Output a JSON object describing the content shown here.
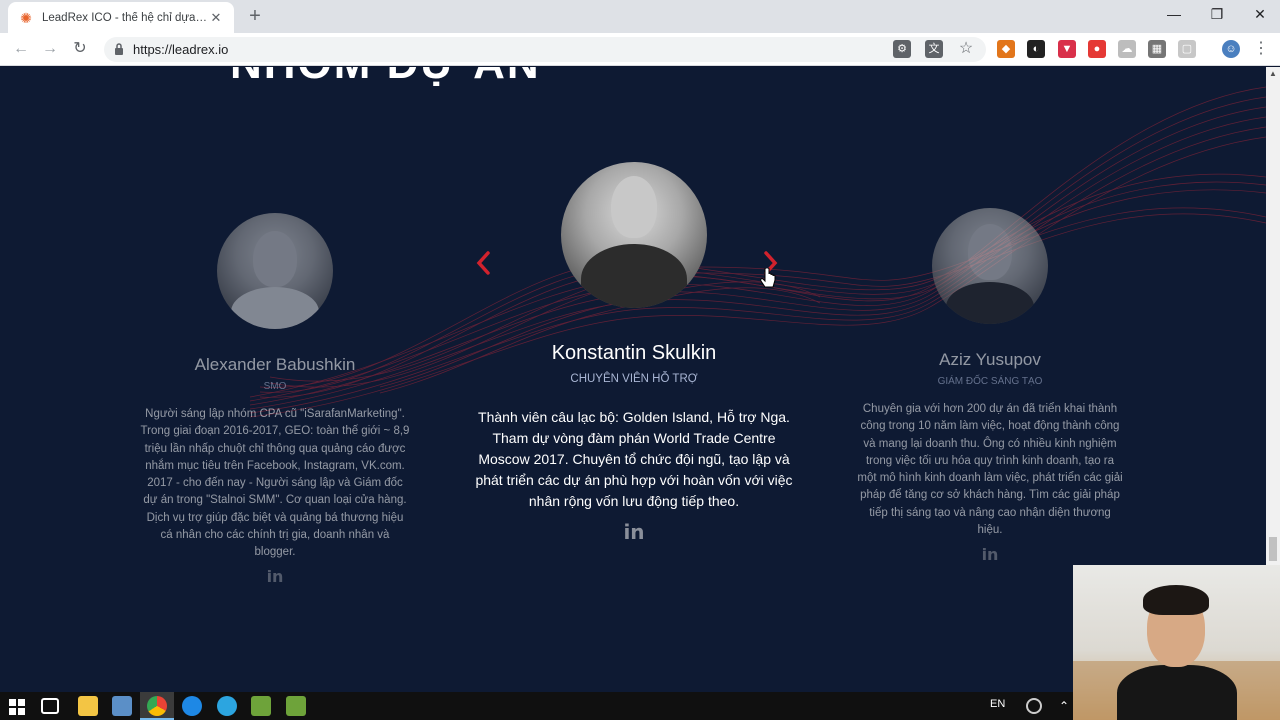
{
  "browser": {
    "tab_title": "LeadRex ICO - thế hệ chỉ dựa trên...",
    "url": "https://leadrex.io"
  },
  "page": {
    "heading": "NHÓM DỰ ÁN",
    "members": [
      {
        "name": "Alexander Babushkin",
        "role": "SMO",
        "bio": "Người sáng lập nhóm CPA cũ \"iSarafanMarketing\". Trong giai đoạn 2016-2017, GEO: toàn thế giới ~ 8,9 triệu lần nhấp chuột chỉ thông qua quảng cáo được nhắm mục tiêu trên Facebook, Instagram, VK.com. 2017 - cho đến nay - Người sáng lập và Giám đốc dự án trong \"Stalnoi SMM\". Cơ quan loại cửa hàng. Dịch vụ trợ giúp đặc biệt và quảng bá thương hiệu cá nhân cho các chính trị gia, doanh nhân và blogger.",
        "social": "in"
      },
      {
        "name": "Konstantin Skulkin",
        "role": "CHUYÊN VIÊN HỖ TRỢ",
        "bio": "Thành viên câu lạc bộ: Golden Island, Hỗ trợ Nga. Tham dự vòng đàm phán World Trade Centre Moscow 2017. Chuyên tổ chức đội ngũ, tạo lập và phát triển các dự án phù hợp với hoàn vốn với việc nhân rộng vốn lưu động tiếp theo.",
        "social": "in"
      },
      {
        "name": "Aziz Yusupov",
        "role": "GIÁM ĐỐC SÁNG TẠO",
        "bio": "Chuyên gia với hơn 200 dự án đã triển khai thành công trong 10 năm làm việc, hoạt động thành công và mang lại doanh thu. Ông có nhiều kinh nghiệm trong việc tối ưu hóa quy trình kinh doanh, tạo ra một mô hình kinh doanh làm việc, phát triển các giải pháp để tăng cơ sở khách hàng. Tìm các giải pháp tiếp thị sáng tạo và nâng cao nhận diện thương hiệu.",
        "social": "in"
      }
    ]
  },
  "taskbar": {
    "lang": "EN"
  },
  "colors": {
    "background": "#0e1a33",
    "accent_red": "#d2222d",
    "role_text": "#a9b6d4"
  }
}
